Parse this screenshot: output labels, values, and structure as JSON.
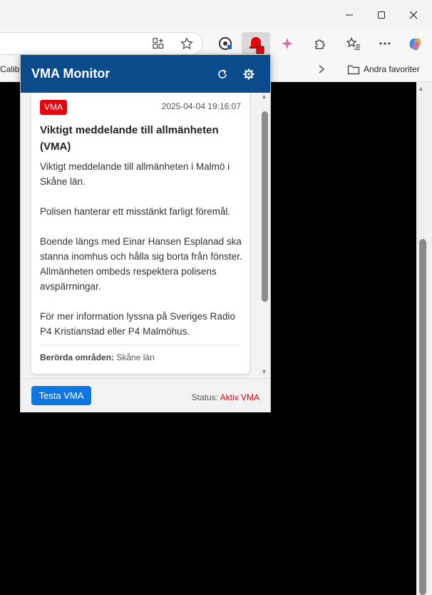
{
  "browser": {
    "favorites_left_text": "Calibr",
    "favorites_folder_label": "Andra favoriter"
  },
  "popup": {
    "title": "VMA Monitor",
    "alert": {
      "badge": "VMA",
      "timestamp": "2025-04-04 19:16:07",
      "title": "Viktigt meddelande till allmänheten (VMA)",
      "paragraphs": [
        "Viktigt meddelande till allmänheten i Malmö i Skåne län.",
        "Polisen hanterar ett misstänkt farligt föremål.",
        "Boende längs med Einar Hansen Esplanad ska stanna inomhus och hålla sig borta från fönster. Allmänheten ombeds respektera polisens avspärrningar.",
        "För mer information lyssna på Sveriges Radio P4 Kristianstad eller P4 Malmöhus."
      ],
      "areas_label": "Berörda områden:",
      "areas_value": "Skåne län"
    },
    "footer": {
      "test_button": "Testa VMA",
      "status_label": "Status:",
      "status_value": "Aktiv VMA"
    }
  },
  "colors": {
    "header": "#0a4b8c",
    "badge": "#e4040e",
    "button": "#0c77e3"
  }
}
